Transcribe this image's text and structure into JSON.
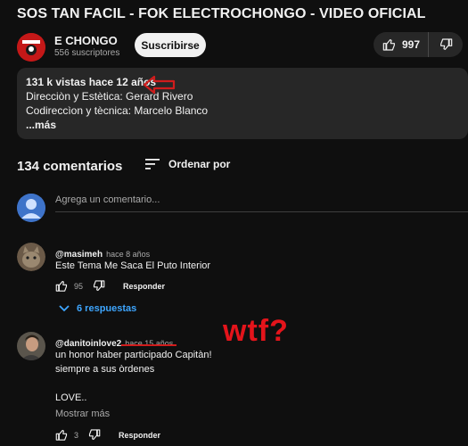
{
  "video": {
    "title": "SOS TAN FACIL - FOK ELECTROCHONGO - VIDEO OFICIAL",
    "channel_name": "E CHONGO",
    "subscribers": "556 suscriptores",
    "subscribe_label": "Suscribirse",
    "likes": "997"
  },
  "description": {
    "meta": "131 k vistas  hace 12 años",
    "line1": "Direcciòn y Estètica: Gerard Rivero",
    "line2": "Codireccìon y tècnica: Marcelo Blanco",
    "more": "...más"
  },
  "comments_header": {
    "count_label": "134 comentarios",
    "sort_label": "Ordenar por",
    "add_placeholder": "Agrega un comentario..."
  },
  "comments": [
    {
      "author": "@masimeh",
      "time": "hace 8 años",
      "text": "Este Tema Me Saca El Puto Interior",
      "likes": "95",
      "reply_label": "Responder",
      "replies_label": "6 respuestas"
    },
    {
      "author": "@danitoinlove2",
      "time": "hace 15 años",
      "line1": "un honor haber participado Capitàn!",
      "line2": "siempre a sus òrdenes",
      "line3": "LOVE..",
      "more_label": "Mostrar más",
      "likes": "3",
      "reply_label": "Responder"
    }
  ],
  "annotation": {
    "text": "wtf?",
    "color": "#e4141b"
  },
  "colors": {
    "background": "#0f0f0f",
    "surface": "#272727",
    "link": "#3ea6ff",
    "annotation_red": "#d01c1c"
  }
}
